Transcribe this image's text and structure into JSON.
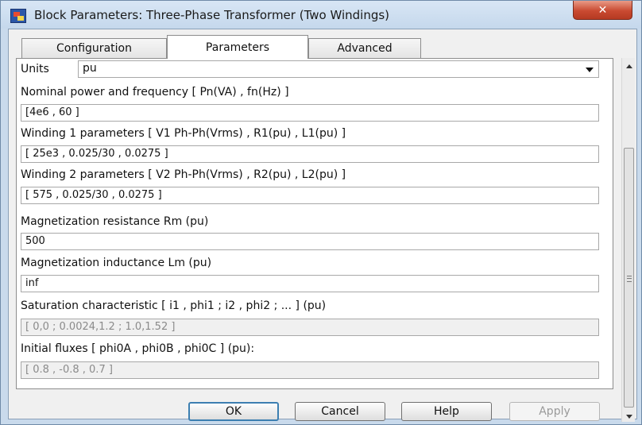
{
  "window": {
    "title": "Block Parameters: Three-Phase Transformer (Two Windings)",
    "close_label": "✕"
  },
  "tabs": [
    {
      "label": "Configuration",
      "active": false
    },
    {
      "label": "Parameters",
      "active": true
    },
    {
      "label": "Advanced",
      "active": false
    }
  ],
  "units": {
    "label": "Units",
    "value": "pu"
  },
  "params": [
    {
      "label": "Nominal power and frequency  [ Pn(VA) , fn(Hz) ]",
      "value": "[4e6 , 60 ]",
      "enabled": true
    },
    {
      "label": "Winding 1 parameters [ V1 Ph-Ph(Vrms) , R1(pu) , L1(pu) ]",
      "value": "[ 25e3 , 0.025/30 , 0.0275 ]",
      "enabled": true
    },
    {
      "label": "Winding 2 parameters [ V2 Ph-Ph(Vrms) , R2(pu) , L2(pu) ]",
      "value": "[ 575 , 0.025/30 , 0.0275 ]",
      "enabled": true
    },
    {
      "label": "Magnetization resistance  Rm (pu)",
      "value": "500",
      "enabled": true
    },
    {
      "label": "Magnetization inductance  Lm (pu)",
      "value": "inf",
      "enabled": true
    },
    {
      "label": "Saturation characteristic [ i1 ,  phi1 ;  i2 , phi2 ; ... ] (pu)",
      "value": "[ 0,0 ; 0.0024,1.2 ; 1.0,1.52 ]",
      "enabled": false
    },
    {
      "label": "Initial fluxes [ phi0A , phi0B , phi0C ] (pu):",
      "value": "[ 0.8 , -0.8 , 0.7 ]",
      "enabled": false
    }
  ],
  "buttons": {
    "ok": "OK",
    "cancel": "Cancel",
    "help": "Help",
    "apply": "Apply"
  }
}
